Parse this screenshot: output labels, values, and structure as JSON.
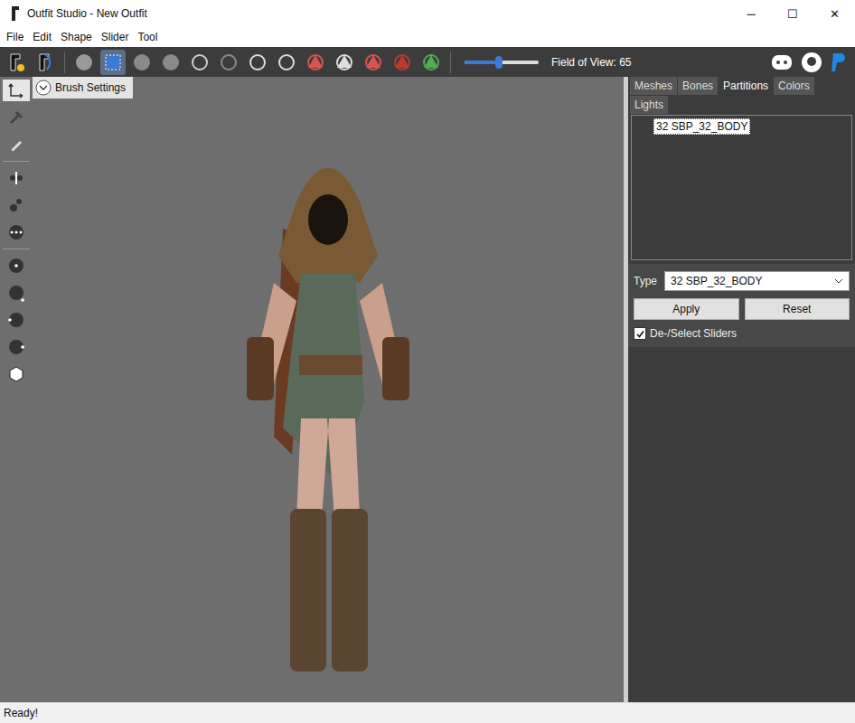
{
  "window": {
    "title": "Outfit Studio - New Outfit",
    "controls": [
      "─",
      "☐",
      "✕"
    ]
  },
  "menu": [
    "File",
    "Edit",
    "Shape",
    "Slider",
    "Tool"
  ],
  "toolbar": {
    "file_tools": [
      {
        "selected": false
      },
      {
        "selected": false
      }
    ],
    "brush_tools": [
      {
        "selected": false
      },
      {
        "selected": true
      },
      {
        "selected": false
      },
      {
        "selected": false
      },
      {
        "selected": false
      },
      {
        "selected": false
      },
      {
        "selected": false
      },
      {
        "selected": false
      },
      {
        "selected": false
      },
      {
        "selected": false
      },
      {
        "selected": false
      },
      {
        "selected": false
      },
      {
        "selected": false
      }
    ],
    "fov_slider": {
      "level": 0.46
    },
    "fov_label": "Field of View: 65"
  },
  "left_tools": [
    {
      "selected": true
    },
    {
      "selected": false
    },
    {
      "selected": false
    },
    {
      "selected": false
    },
    {
      "selected": false
    },
    {
      "selected": false
    },
    {
      "selected": false
    },
    {
      "selected": false
    },
    {
      "selected": false
    },
    {
      "selected": false
    },
    {
      "selected": false
    }
  ],
  "brush_settings": {
    "label": "Brush Settings",
    "expanded": false
  },
  "tabs": [
    {
      "label": "Meshes",
      "selected": false
    },
    {
      "label": "Bones",
      "selected": false
    },
    {
      "label": "Partitions",
      "selected": true
    },
    {
      "label": "Colors",
      "selected": false
    },
    {
      "label": "Lights",
      "selected": false
    }
  ],
  "partitions": [
    {
      "label": "32 SBP_32_BODY",
      "selected": true
    }
  ],
  "type": {
    "label": "Type",
    "value": "32 SBP_32_BODY"
  },
  "buttons": [
    "Apply",
    "Reset"
  ],
  "checkbox": {
    "label": "De-/Select Sliders",
    "checked": true
  },
  "status_bar": "Ready!"
}
